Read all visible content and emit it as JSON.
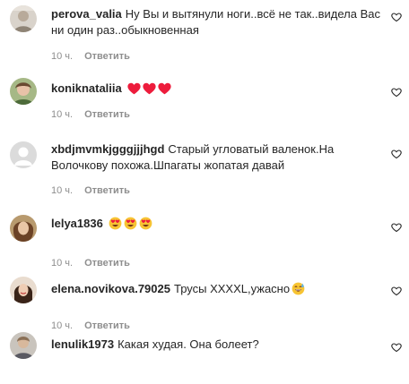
{
  "comments": [
    {
      "username": "perova_valia",
      "text": "Ну Вы и вытянули ноги..всё не так..видела Вас ни один раз..обыкновенная",
      "time": "10 ч.",
      "reply": "Ответить",
      "avatar_icon": "user-photo-avatar"
    },
    {
      "username": "koniknataliia",
      "text": "",
      "emojis": [
        "red-heart-emoji",
        "red-heart-emoji",
        "red-heart-emoji"
      ],
      "time": "10 ч.",
      "reply": "Ответить",
      "avatar_icon": "user-photo-avatar"
    },
    {
      "username": "xbdjmvmkjgggjjjhgd",
      "text": "Старый угловатый валенок.На Волочкову похожа.Шпагаты жопатая давай",
      "time": "10 ч.",
      "reply": "Ответить",
      "avatar_icon": "default-avatar"
    },
    {
      "username": "lelya1836",
      "text": "",
      "emojis": [
        "heart-eyes-emoji",
        "heart-eyes-emoji",
        "heart-eyes-emoji"
      ],
      "time": "10 ч.",
      "reply": "Ответить",
      "avatar_icon": "user-photo-avatar"
    },
    {
      "username": "elena.novikova.79025",
      "text": "Трусы XXXXL,ужасно",
      "emojis": [
        "grinning-sweat-emoji"
      ],
      "time": "10 ч.",
      "reply": "Ответить",
      "avatar_icon": "user-photo-avatar"
    },
    {
      "username": "lenulik1973",
      "text": "Какая худая. Она болеет?",
      "time": "10 ч.",
      "reply": "",
      "avatar_icon": "user-photo-avatar"
    }
  ],
  "colors": {
    "text": "#262626",
    "muted": "#8e8e8e",
    "heart_emoji": "#ed1c3c",
    "emoji_face": "#f7c433"
  },
  "like_icon": "heart-outline-icon"
}
